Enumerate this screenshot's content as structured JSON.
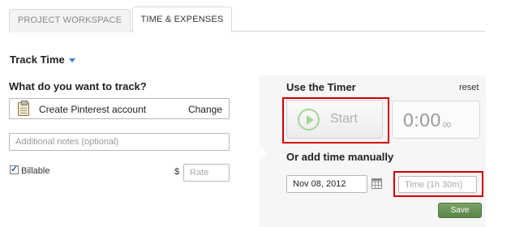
{
  "tabs": [
    {
      "label": "PROJECT WORKSPACE"
    },
    {
      "label": "TIME & EXPENSES"
    }
  ],
  "track": {
    "title": "Track Time"
  },
  "what": {
    "label": "What do you want to track?",
    "project_name": "Create Pinterest account",
    "change_label": "Change",
    "notes_placeholder": "Additional notes (optional)",
    "billable_label": "Billable",
    "currency": "$",
    "rate_placeholder": "Rate"
  },
  "timer": {
    "title": "Use the Timer",
    "reset_label": "reset",
    "start_label": "Start",
    "time_main": "0:00",
    "time_small": "00"
  },
  "manual": {
    "title": "Or add time manually",
    "date_value": "Nov 08, 2012",
    "time_placeholder": "Time (1h 30m)",
    "save_label": "Save"
  },
  "colors": {
    "accent_blue": "#3a86c8",
    "highlight_red": "#d20000",
    "save_green": "#5b8548",
    "play_green": "#a7d39a"
  }
}
